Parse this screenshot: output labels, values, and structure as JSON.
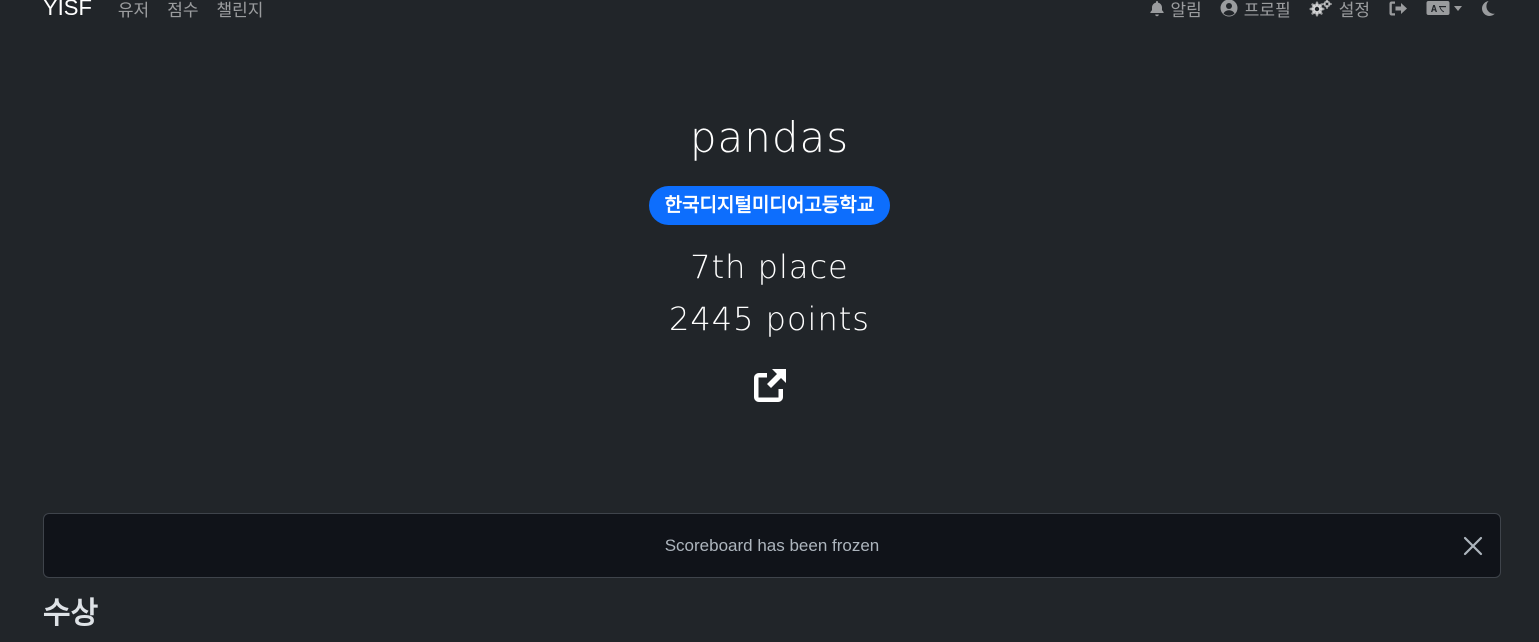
{
  "navbar": {
    "brand": "YISF",
    "links": [
      {
        "label": "유저"
      },
      {
        "label": "점수"
      },
      {
        "label": "챌린지"
      }
    ],
    "right": {
      "notifications_label": "알림",
      "profile_label": "프로필",
      "settings_label": "설정"
    }
  },
  "team": {
    "name": "pandas",
    "school": "한국디지털미디어고등학교",
    "place": "7th place",
    "points": "2445 points"
  },
  "alert": {
    "message": "Scoreboard has been frozen"
  },
  "section": {
    "title": "수상"
  },
  "colors": {
    "background": "#212529",
    "badge": "#0d6efd",
    "alert_bg": "#101319"
  },
  "icons": [
    "bell-icon",
    "user-circle-icon",
    "cogs-icon",
    "sign-out-icon",
    "language-icon",
    "moon-icon",
    "external-link-icon",
    "close-icon"
  ]
}
